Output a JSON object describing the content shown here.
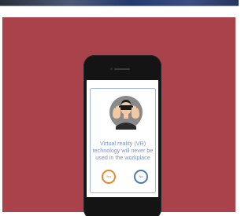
{
  "quiz": {
    "question": "Virtual reality (VR) technology will never be used in the workplace",
    "answers": {
      "yes_label": "Yes",
      "no_label": "No"
    }
  },
  "colors": {
    "panel": "#a9424b",
    "yes": "#e58a2b",
    "no": "#4e79b8",
    "question_text": "#7a93c4"
  },
  "icons": {
    "avatar": "vr-headset-person-icon"
  }
}
